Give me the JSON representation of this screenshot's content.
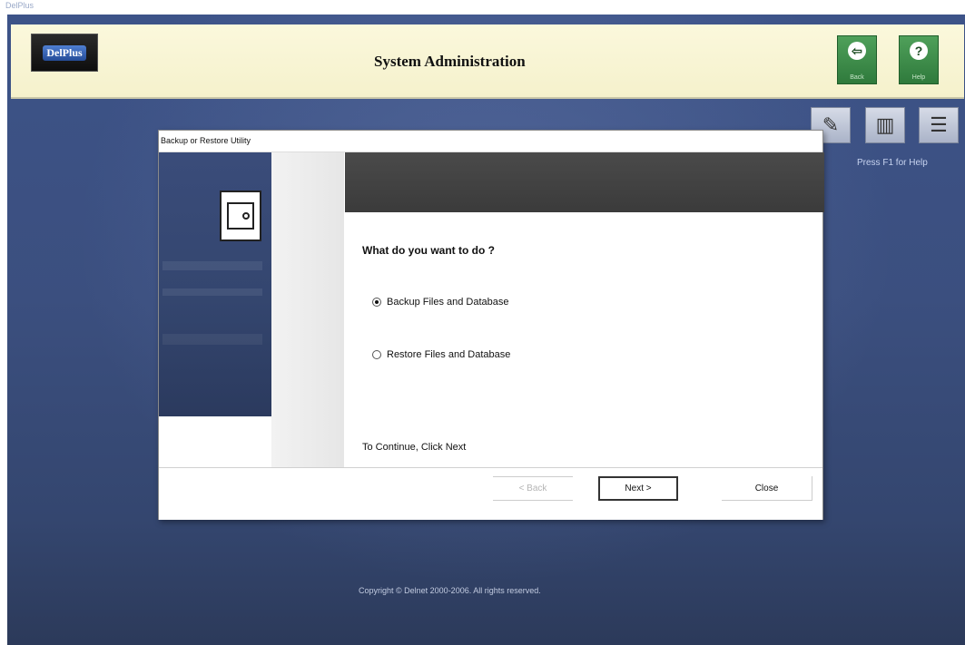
{
  "window": {
    "title": "DelPlus"
  },
  "header": {
    "logo_text": "DelPlus",
    "title": "System Administration",
    "back_label": "Back",
    "help_label": "Help"
  },
  "toolbar": {
    "hint": "Press F1 for Help"
  },
  "dialog": {
    "title": "Backup or Restore Utility",
    "question": "What do you want to do ?",
    "options": [
      {
        "label": "Backup Files and Database",
        "selected": true
      },
      {
        "label": "Restore Files and Database",
        "selected": false
      }
    ],
    "instruction": "To Continue, Click Next",
    "buttons": {
      "back": "< Back",
      "next": "Next >",
      "close": "Close"
    }
  },
  "footer": {
    "copyright": "Copyright © Delnet 2000-2006. All rights reserved."
  },
  "colors": {
    "header_bg": "#f5f1cc",
    "desktop_bg": "#3b4f7f",
    "action_button": "#2f7a3c"
  },
  "icons": {
    "back": "arrow-left-icon",
    "help": "question-icon",
    "tool1": "edit-card-icon",
    "tool2": "books-icon",
    "tool3": "list-icon",
    "dialog": "safe-icon"
  }
}
